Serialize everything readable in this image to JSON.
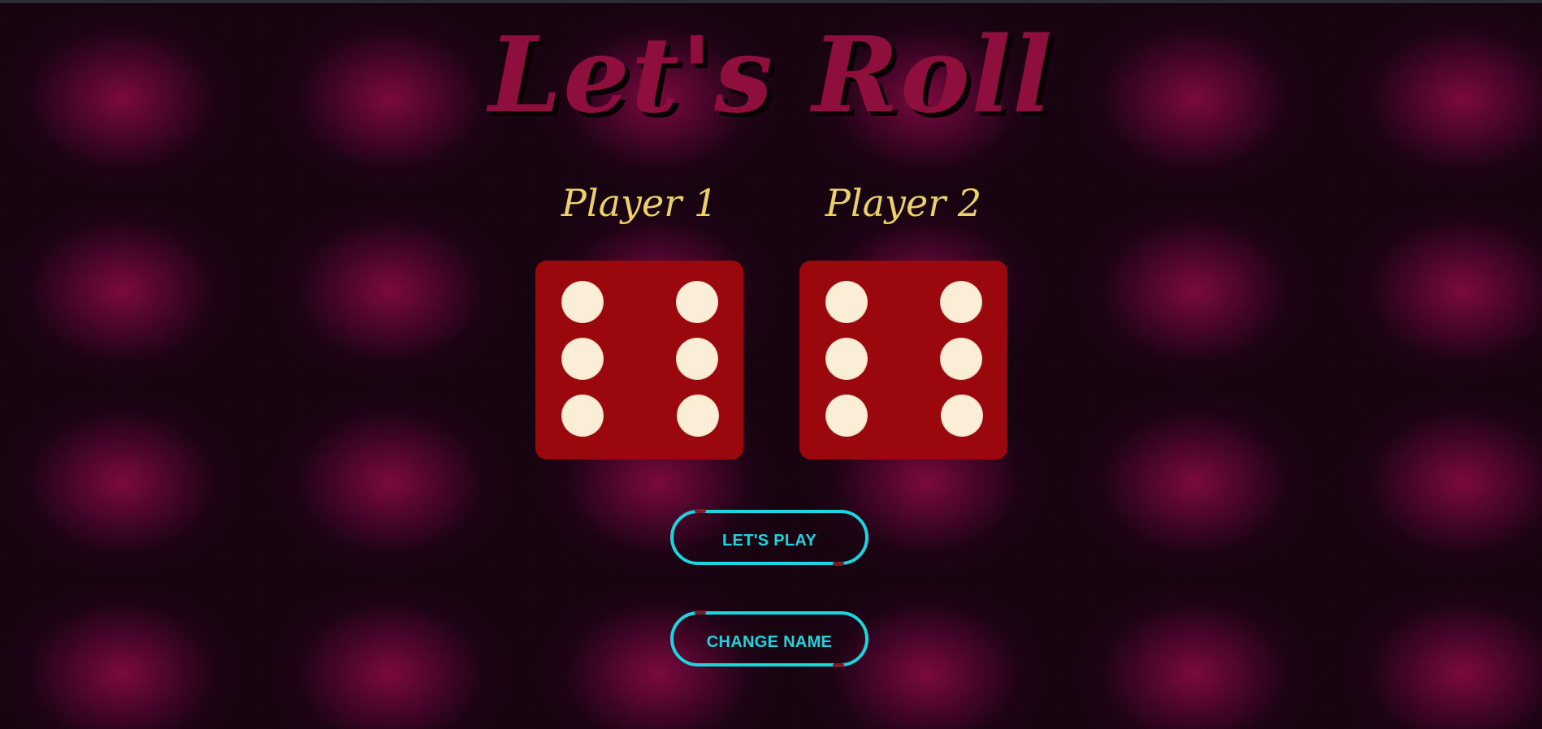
{
  "app": {
    "title": "Let's Roll"
  },
  "players": [
    {
      "name": "Player 1",
      "die_value": 6
    },
    {
      "name": "Player 2",
      "die_value": 6
    }
  ],
  "buttons": {
    "play_label": "LET'S PLAY",
    "change_name_label": "CHANGE NAME"
  },
  "colors": {
    "title": "#8e0f3e",
    "player_name": "#ead16a",
    "die_face": "#9a070d",
    "pip": "#faeed6",
    "button_accent": "#1cd6df"
  }
}
